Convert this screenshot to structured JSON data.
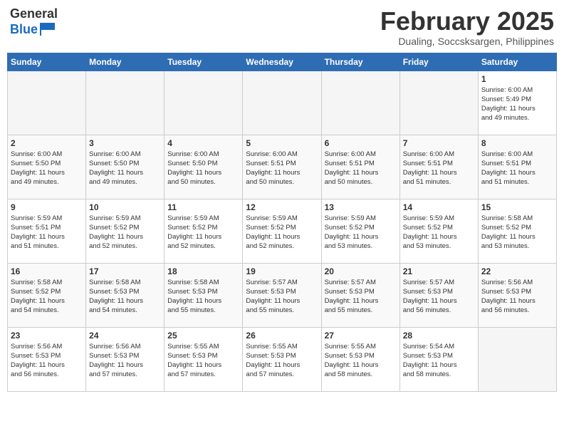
{
  "header": {
    "logo_general": "General",
    "logo_blue": "Blue",
    "month_title": "February 2025",
    "location": "Dualing, Soccsksargen, Philippines"
  },
  "weekdays": [
    "Sunday",
    "Monday",
    "Tuesday",
    "Wednesday",
    "Thursday",
    "Friday",
    "Saturday"
  ],
  "weeks": [
    [
      {
        "day": "",
        "info": ""
      },
      {
        "day": "",
        "info": ""
      },
      {
        "day": "",
        "info": ""
      },
      {
        "day": "",
        "info": ""
      },
      {
        "day": "",
        "info": ""
      },
      {
        "day": "",
        "info": ""
      },
      {
        "day": "1",
        "info": "Sunrise: 6:00 AM\nSunset: 5:49 PM\nDaylight: 11 hours\nand 49 minutes."
      }
    ],
    [
      {
        "day": "2",
        "info": "Sunrise: 6:00 AM\nSunset: 5:50 PM\nDaylight: 11 hours\nand 49 minutes."
      },
      {
        "day": "3",
        "info": "Sunrise: 6:00 AM\nSunset: 5:50 PM\nDaylight: 11 hours\nand 49 minutes."
      },
      {
        "day": "4",
        "info": "Sunrise: 6:00 AM\nSunset: 5:50 PM\nDaylight: 11 hours\nand 50 minutes."
      },
      {
        "day": "5",
        "info": "Sunrise: 6:00 AM\nSunset: 5:51 PM\nDaylight: 11 hours\nand 50 minutes."
      },
      {
        "day": "6",
        "info": "Sunrise: 6:00 AM\nSunset: 5:51 PM\nDaylight: 11 hours\nand 50 minutes."
      },
      {
        "day": "7",
        "info": "Sunrise: 6:00 AM\nSunset: 5:51 PM\nDaylight: 11 hours\nand 51 minutes."
      },
      {
        "day": "8",
        "info": "Sunrise: 6:00 AM\nSunset: 5:51 PM\nDaylight: 11 hours\nand 51 minutes."
      }
    ],
    [
      {
        "day": "9",
        "info": "Sunrise: 5:59 AM\nSunset: 5:51 PM\nDaylight: 11 hours\nand 51 minutes."
      },
      {
        "day": "10",
        "info": "Sunrise: 5:59 AM\nSunset: 5:52 PM\nDaylight: 11 hours\nand 52 minutes."
      },
      {
        "day": "11",
        "info": "Sunrise: 5:59 AM\nSunset: 5:52 PM\nDaylight: 11 hours\nand 52 minutes."
      },
      {
        "day": "12",
        "info": "Sunrise: 5:59 AM\nSunset: 5:52 PM\nDaylight: 11 hours\nand 52 minutes."
      },
      {
        "day": "13",
        "info": "Sunrise: 5:59 AM\nSunset: 5:52 PM\nDaylight: 11 hours\nand 53 minutes."
      },
      {
        "day": "14",
        "info": "Sunrise: 5:59 AM\nSunset: 5:52 PM\nDaylight: 11 hours\nand 53 minutes."
      },
      {
        "day": "15",
        "info": "Sunrise: 5:58 AM\nSunset: 5:52 PM\nDaylight: 11 hours\nand 53 minutes."
      }
    ],
    [
      {
        "day": "16",
        "info": "Sunrise: 5:58 AM\nSunset: 5:52 PM\nDaylight: 11 hours\nand 54 minutes."
      },
      {
        "day": "17",
        "info": "Sunrise: 5:58 AM\nSunset: 5:53 PM\nDaylight: 11 hours\nand 54 minutes."
      },
      {
        "day": "18",
        "info": "Sunrise: 5:58 AM\nSunset: 5:53 PM\nDaylight: 11 hours\nand 55 minutes."
      },
      {
        "day": "19",
        "info": "Sunrise: 5:57 AM\nSunset: 5:53 PM\nDaylight: 11 hours\nand 55 minutes."
      },
      {
        "day": "20",
        "info": "Sunrise: 5:57 AM\nSunset: 5:53 PM\nDaylight: 11 hours\nand 55 minutes."
      },
      {
        "day": "21",
        "info": "Sunrise: 5:57 AM\nSunset: 5:53 PM\nDaylight: 11 hours\nand 56 minutes."
      },
      {
        "day": "22",
        "info": "Sunrise: 5:56 AM\nSunset: 5:53 PM\nDaylight: 11 hours\nand 56 minutes."
      }
    ],
    [
      {
        "day": "23",
        "info": "Sunrise: 5:56 AM\nSunset: 5:53 PM\nDaylight: 11 hours\nand 56 minutes."
      },
      {
        "day": "24",
        "info": "Sunrise: 5:56 AM\nSunset: 5:53 PM\nDaylight: 11 hours\nand 57 minutes."
      },
      {
        "day": "25",
        "info": "Sunrise: 5:55 AM\nSunset: 5:53 PM\nDaylight: 11 hours\nand 57 minutes."
      },
      {
        "day": "26",
        "info": "Sunrise: 5:55 AM\nSunset: 5:53 PM\nDaylight: 11 hours\nand 57 minutes."
      },
      {
        "day": "27",
        "info": "Sunrise: 5:55 AM\nSunset: 5:53 PM\nDaylight: 11 hours\nand 58 minutes."
      },
      {
        "day": "28",
        "info": "Sunrise: 5:54 AM\nSunset: 5:53 PM\nDaylight: 11 hours\nand 58 minutes."
      },
      {
        "day": "",
        "info": ""
      }
    ]
  ]
}
